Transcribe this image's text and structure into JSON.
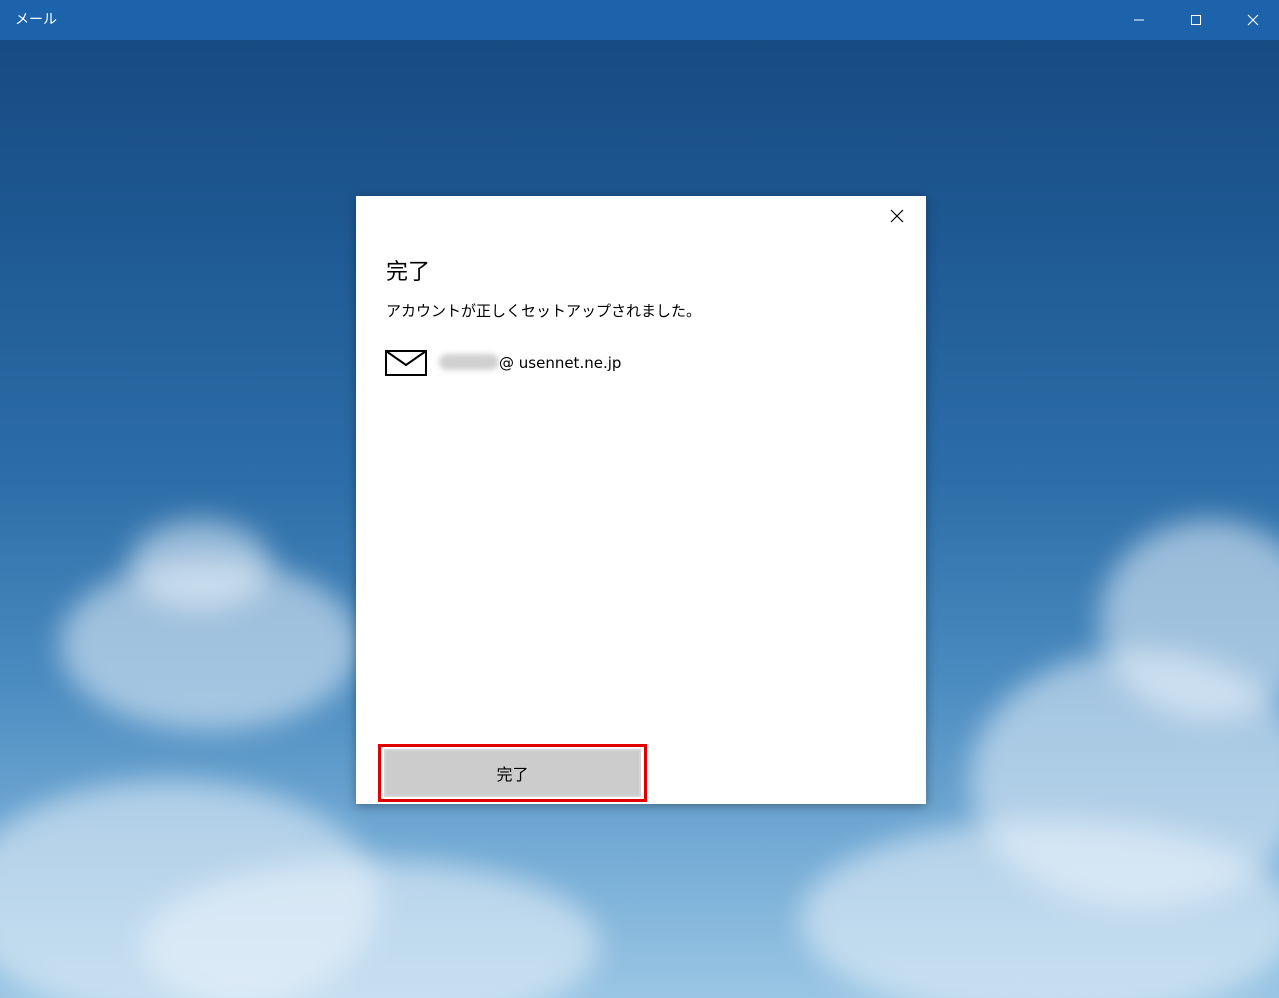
{
  "window": {
    "title": "メール",
    "controls": {
      "minimize_icon": "minimize-icon",
      "maximize_icon": "maximize-icon",
      "close_icon": "close-icon"
    },
    "titlebar_color": "#1c63ac"
  },
  "dialog": {
    "close_icon": "close-icon",
    "title": "完了",
    "message": "アカウントが正しくセットアップされました。",
    "account": {
      "icon": "envelope-icon",
      "domain": "@ usennet.ne.jp"
    },
    "done_button_label": "完了",
    "highlight_color": "#e00000"
  }
}
